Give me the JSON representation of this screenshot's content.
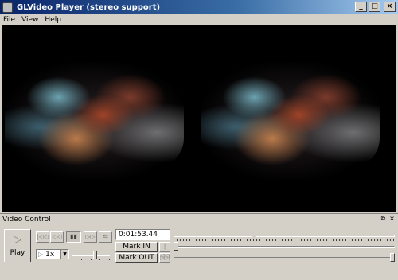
{
  "window": {
    "title": "GLVideo Player (stereo support)",
    "controls": [
      "_",
      "□",
      "×"
    ]
  },
  "menu": {
    "items": [
      "File",
      "View",
      "Help"
    ]
  },
  "video": {
    "mode": "side-by-side stereo",
    "background": "#000000"
  },
  "dock": {
    "title": "Video Control",
    "buttons": [
      "⧉",
      "×"
    ]
  },
  "controls": {
    "play_label": "Play",
    "play_icon": "play-icon",
    "transport": [
      {
        "name": "jump-start-icon",
        "glyph": "|◁◁"
      },
      {
        "name": "step-back-icon",
        "glyph": "◁◁"
      },
      {
        "name": "pause-icon",
        "glyph": "▮▮"
      },
      {
        "name": "step-forward-icon",
        "glyph": "▷▷"
      },
      {
        "name": "loop-icon",
        "glyph": "⇆"
      }
    ],
    "speed_value": "1x",
    "speed_slider_fraction": 0.62,
    "time_display": "0:01:53.44",
    "mark_in_label": "Mark IN",
    "mark_out_label": "Mark OUT",
    "position_fraction": 0.36,
    "mark_in_fraction": 0.0,
    "mark_out_fraction": 1.0
  }
}
